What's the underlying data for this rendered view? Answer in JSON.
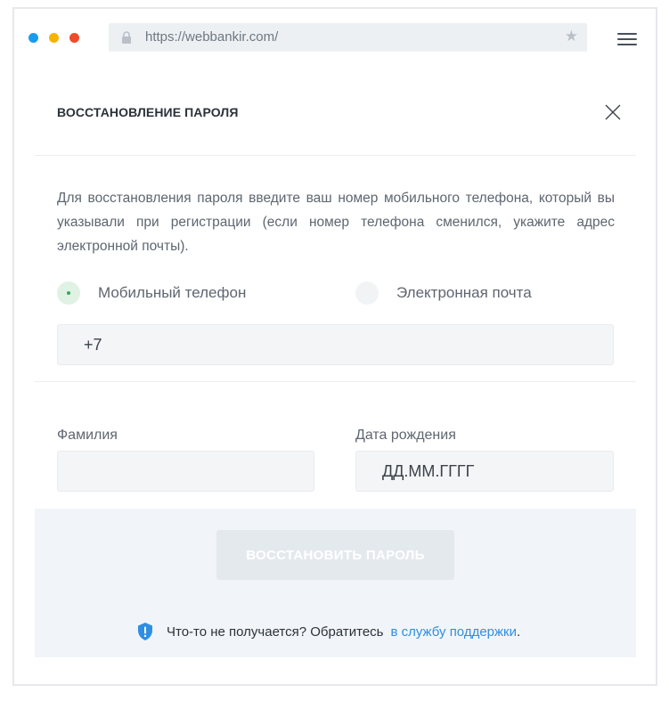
{
  "browser": {
    "url": "https://webbankir.com/",
    "window_dots": [
      "#1a9bf0",
      "#f6b300",
      "#ee4b2b"
    ]
  },
  "modal": {
    "title": "ВОССТАНОВЛЕНИЕ ПАРОЛЯ",
    "description": "Для восстановления пароля введите ваш номер мобильного телефона, который вы указывали при регистрации (если номер телефона сменился, укажите адрес электронной почты).",
    "radio_options": [
      {
        "label": "Мобильный телефон",
        "checked": true
      },
      {
        "label": "Электронная почта",
        "checked": false
      }
    ],
    "phone_value": "+7",
    "lastname_label": "Фамилия",
    "lastname_value": "",
    "birthdate_label": "Дата рождения",
    "birthdate_placeholder": "ДД.ММ.ГГГГ",
    "submit_label": "ВОССТАНОВИТЬ ПАРОЛЬ",
    "help_text": "Что-то не получается? Обратитесь",
    "help_link": "в службу поддержки",
    "help_suffix": "."
  },
  "colors": {
    "accent_link": "#2f8ee5",
    "radio_checked": "#3aa957",
    "footer_bg": "#f1f5f9",
    "help_icon": "#2f8ee5"
  }
}
